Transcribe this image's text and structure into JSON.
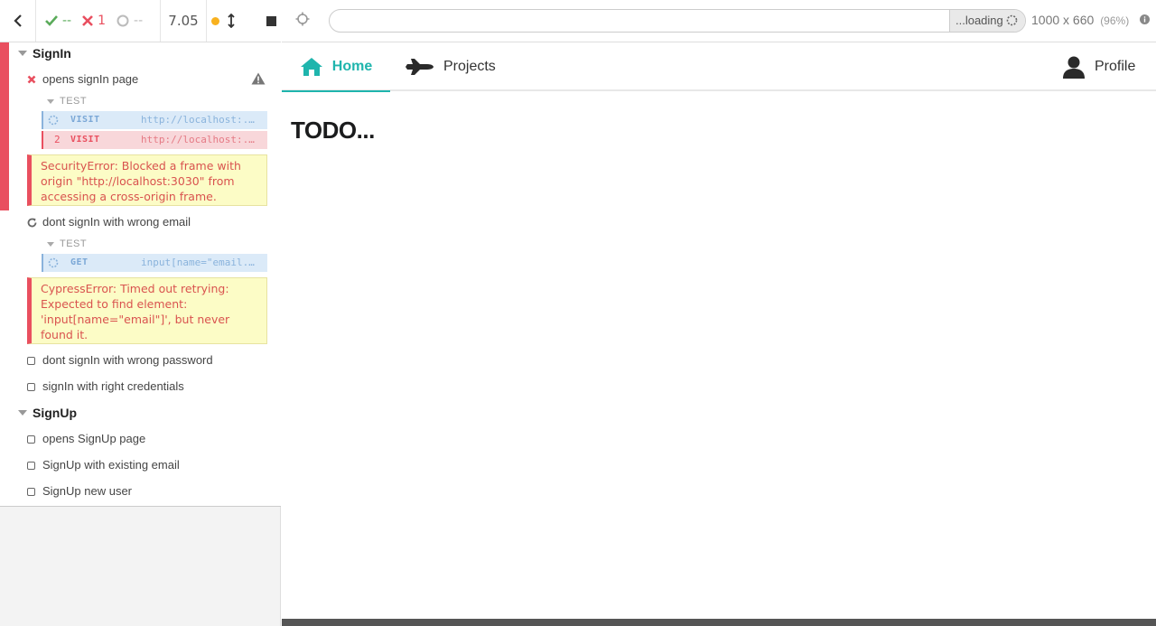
{
  "header": {
    "passed": "--",
    "failed": "1",
    "pending": "--",
    "duration": "7.05"
  },
  "suites": [
    {
      "title": "SignIn",
      "tests": [
        {
          "title": "opens signIn page",
          "state": "failed",
          "test_label": "TEST",
          "commands": [
            {
              "num": "",
              "name": "VISIT",
              "message": "http://localhost:...",
              "state": "pending"
            },
            {
              "num": "2",
              "name": "VISIT",
              "message": "http://localhost:...",
              "state": "failed"
            }
          ],
          "error": "SecurityError: Blocked a frame with origin \"http://localhost:3030\" from accessing a cross-origin frame."
        },
        {
          "title": "dont signIn with wrong email",
          "state": "running",
          "test_label": "TEST",
          "commands": [
            {
              "num": "",
              "name": "GET",
              "message": "input[name=\"email...",
              "state": "pending"
            }
          ],
          "error": "CypressError: Timed out retrying: Expected to find element: 'input[name=\"email\"]', but never found it."
        },
        {
          "title": "dont signIn with wrong password",
          "state": "pending"
        },
        {
          "title": "signIn with right credentials",
          "state": "pending"
        }
      ]
    },
    {
      "title": "SignUp",
      "tests": [
        {
          "title": "opens SignUp page",
          "state": "pending"
        },
        {
          "title": "SignUp with existing email",
          "state": "pending"
        },
        {
          "title": "SignUp new user",
          "state": "pending"
        }
      ]
    }
  ],
  "browser": {
    "url": "",
    "loading_label": "...loading",
    "viewport_size": "1000 x 660",
    "viewport_scale": "(96%)"
  },
  "app": {
    "nav": {
      "home": "Home",
      "projects": "Projects",
      "profile": "Profile"
    },
    "content_title": "TODO..."
  },
  "colors": {
    "passed": "#5aab5a",
    "failed": "#e94f5f",
    "running": "#f8b11f",
    "accent": "#1fb5ad"
  }
}
